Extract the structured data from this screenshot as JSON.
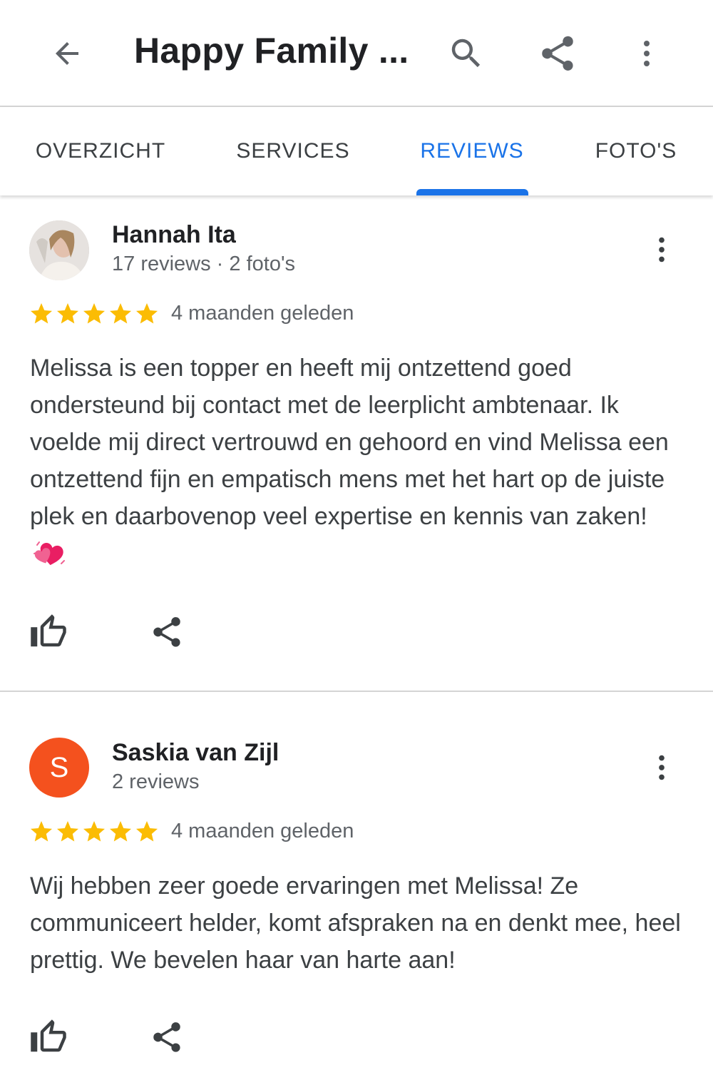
{
  "header": {
    "title": "Happy Family ...",
    "back_icon": "arrow-back-icon",
    "search_icon": "search-icon",
    "share_icon": "share-icon",
    "more_icon": "more-vert-icon"
  },
  "tabs": [
    {
      "label": "OVERZICHT",
      "active": false
    },
    {
      "label": "SERVICES",
      "active": false
    },
    {
      "label": "REVIEWS",
      "active": true
    },
    {
      "label": "FOTO'S",
      "active": false
    }
  ],
  "colors": {
    "accent": "#1a73e8",
    "star": "#fbbc04",
    "avatar_orange": "#f4511e"
  },
  "reviews": [
    {
      "author": "Hannah Ita",
      "meta": "17 reviews · 2 foto's",
      "rating": 5,
      "date": "4 maanden geleden",
      "text": "Melissa is een topper en heeft mij ontzettend goed ondersteund bij contact met de leerplicht ambtenaar. Ik voelde mij direct vertrouwd en gehoord en vind Melissa een ontzettend fijn en empatisch mens met het hart op de juiste plek en daarbovenop veel expertise en kennis van zaken!",
      "emoji": "two-hearts-emoji",
      "avatar": "profile-photo"
    },
    {
      "author": "Saskia van Zijl",
      "meta": "2 reviews",
      "rating": 5,
      "date": "4 maanden geleden",
      "text": "Wij hebben zeer goede ervaringen met Melissa! Ze communiceert helder, komt afspraken na en denkt mee, heel prettig. We bevelen haar van harte aan!",
      "avatar_letter": "S"
    }
  ]
}
